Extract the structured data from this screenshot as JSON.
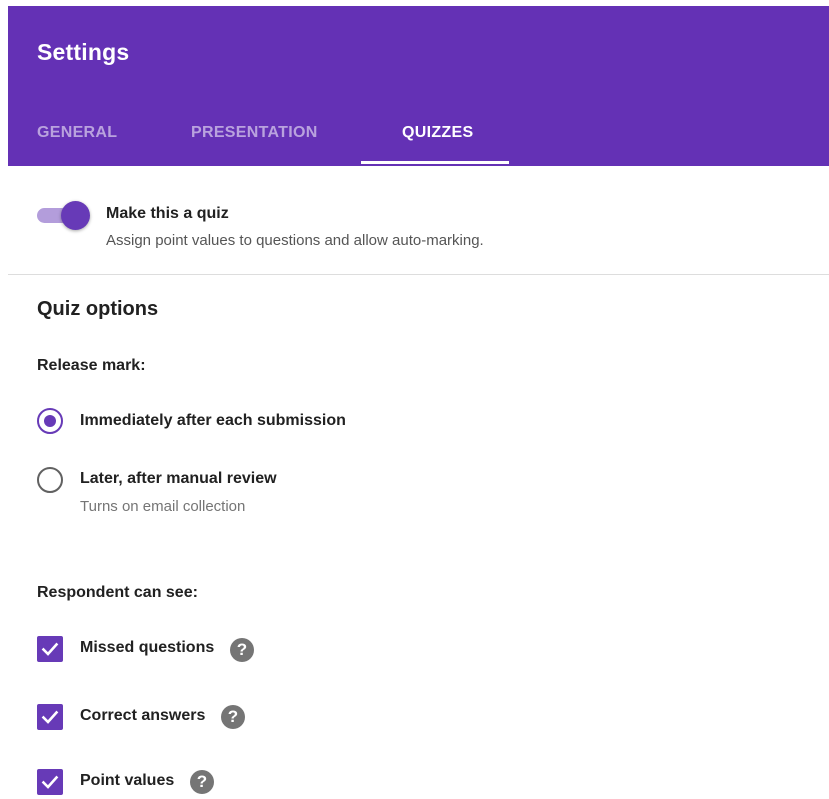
{
  "header": {
    "title": "Settings",
    "tabs": [
      {
        "label": "GENERAL",
        "active": false
      },
      {
        "label": "PRESENTATION",
        "active": false
      },
      {
        "label": "QUIZZES",
        "active": true
      }
    ]
  },
  "quiz_toggle": {
    "on": true,
    "title": "Make this a quiz",
    "description": "Assign point values to questions and allow auto-marking."
  },
  "quiz_options": {
    "title": "Quiz options",
    "release_mark": {
      "label": "Release mark:",
      "options": [
        {
          "label": "Immediately after each submission",
          "help": "",
          "selected": true
        },
        {
          "label": "Later, after manual review",
          "help": "Turns on email collection",
          "selected": false
        }
      ]
    },
    "respondent_can_see": {
      "label": "Respondent can see:",
      "options": [
        {
          "label": "Missed questions",
          "checked": true
        },
        {
          "label": "Correct answers",
          "checked": true
        },
        {
          "label": "Point values",
          "checked": true
        }
      ]
    }
  },
  "help_icon_glyph": "?",
  "colors": {
    "header": "#6431b5",
    "accent": "#673ab7",
    "toggle_track": "#b39ddb"
  }
}
